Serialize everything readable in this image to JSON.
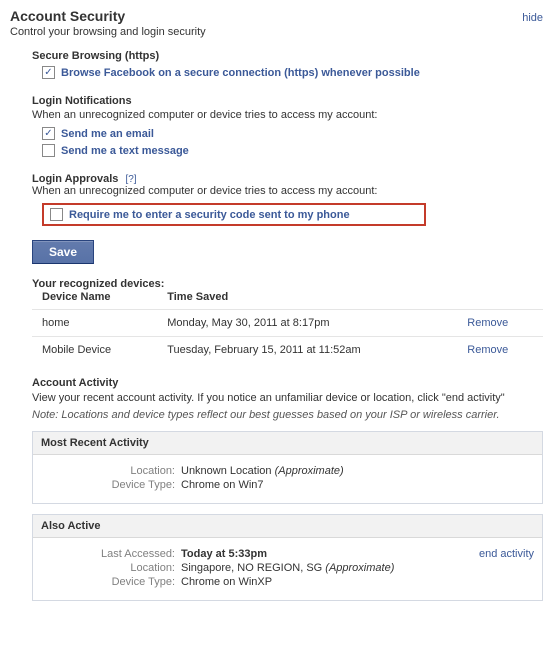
{
  "header": {
    "title": "Account Security",
    "subtitle": "Control your browsing and login security",
    "hide_label": "hide"
  },
  "secure_browsing": {
    "title": "Secure Browsing (https)",
    "checkbox_label": "Browse Facebook on a secure connection (https) whenever possible",
    "checked": true
  },
  "login_notifications": {
    "title": "Login Notifications",
    "desc": "When an unrecognized computer or device tries to access my account:",
    "email_label": "Send me an email",
    "email_checked": true,
    "sms_label": "Send me a text message",
    "sms_checked": false
  },
  "login_approvals": {
    "title": "Login Approvals",
    "help": "[?]",
    "desc": "When an unrecognized computer or device tries to access my account:",
    "checkbox_label": "Require me to enter a security code sent to my phone",
    "checked": false
  },
  "save_label": "Save",
  "devices": {
    "title": "Your recognized devices:",
    "col_name": "Device Name",
    "col_time": "Time Saved",
    "remove_label": "Remove",
    "rows": [
      {
        "name": "home",
        "time": "Monday, May 30, 2011 at 8:17pm"
      },
      {
        "name": "Mobile Device",
        "time": "Tuesday, February 15, 2011 at 11:52am"
      }
    ]
  },
  "activity": {
    "title": "Account Activity",
    "desc": "View your recent account activity. If you notice an unfamiliar device or location, click \"end activity\"",
    "note": "Note: Locations and device types reflect our best guesses based on your ISP or wireless carrier.",
    "most_recent": {
      "header": "Most Recent Activity",
      "location_key": "Location:",
      "location_val": "Unknown Location",
      "location_suffix": "(Approximate)",
      "device_key": "Device Type:",
      "device_val": "Chrome on Win7"
    },
    "also_active": {
      "header": "Also Active",
      "end_activity_label": "end activity",
      "last_accessed_key": "Last Accessed:",
      "last_accessed_val": "Today at 5:33pm",
      "location_key": "Location:",
      "location_val": "Singapore, NO REGION, SG",
      "location_suffix": "(Approximate)",
      "device_key": "Device Type:",
      "device_val": "Chrome on WinXP"
    }
  }
}
